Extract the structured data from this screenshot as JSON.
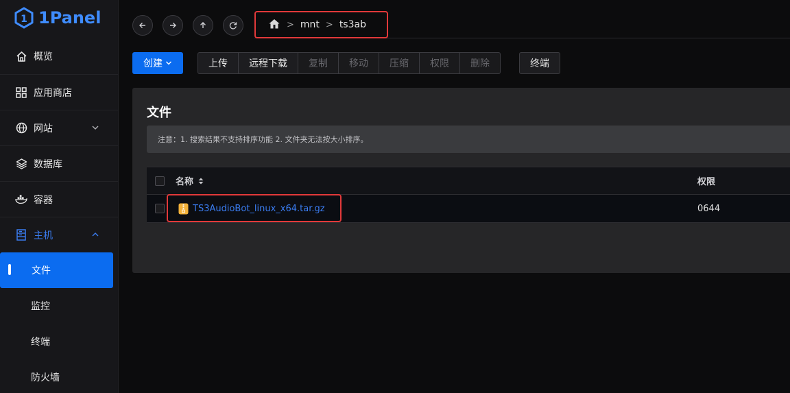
{
  "app": {
    "logo_text": "1Panel",
    "accent": "#0b6cf0",
    "highlight": "#e2393a"
  },
  "sidebar": {
    "items": [
      {
        "label": "概览",
        "icon": "home-icon"
      },
      {
        "label": "应用商店",
        "icon": "grid-icon"
      },
      {
        "label": "网站",
        "icon": "globe-icon",
        "expandable": true,
        "expanded": false
      },
      {
        "label": "数据库",
        "icon": "layers-icon"
      },
      {
        "label": "容器",
        "icon": "docker-icon"
      },
      {
        "label": "主机",
        "icon": "server-icon",
        "expandable": true,
        "expanded": true
      }
    ],
    "host_subitems": [
      {
        "label": "文件",
        "active": true
      },
      {
        "label": "监控",
        "active": false
      },
      {
        "label": "终端",
        "active": false
      },
      {
        "label": "防火墙",
        "active": false
      }
    ]
  },
  "nav": {
    "buttons": [
      "back-icon",
      "forward-icon",
      "up-icon",
      "refresh-icon"
    ],
    "breadcrumb": {
      "home_icon": "home-icon",
      "separator": ">",
      "segments": [
        "mnt",
        "ts3ab"
      ]
    }
  },
  "toolbar": {
    "create_label": "创建",
    "buttons": [
      {
        "label": "上传",
        "disabled": false
      },
      {
        "label": "远程下载",
        "disabled": false
      },
      {
        "label": "复制",
        "disabled": true
      },
      {
        "label": "移动",
        "disabled": true
      },
      {
        "label": "压缩",
        "disabled": true
      },
      {
        "label": "权限",
        "disabled": true
      },
      {
        "label": "删除",
        "disabled": true
      }
    ],
    "terminal_label": "终端"
  },
  "files": {
    "title": "文件",
    "notice": "注意：1. 搜索结果不支持排序功能 2. 文件夹无法按大小排序。",
    "columns": {
      "name": "名称",
      "permission": "权限"
    },
    "rows": [
      {
        "name": "TS3AudioBot_linux_x64.tar.gz",
        "permission": "0644",
        "icon": "archive-file-icon"
      }
    ]
  }
}
